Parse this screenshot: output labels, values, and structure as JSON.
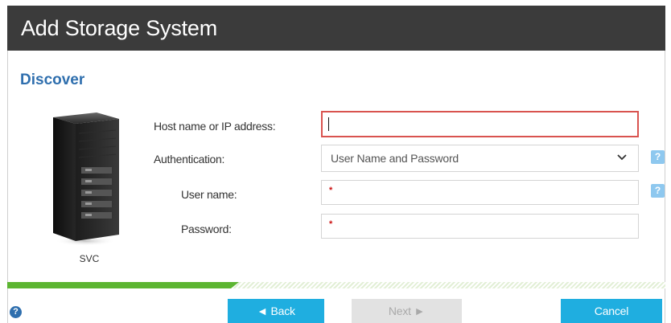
{
  "dialog": {
    "title": "Add Storage System",
    "section_title": "Discover"
  },
  "device": {
    "name": "SVC"
  },
  "form": {
    "host_label": "Host name or IP address:",
    "host_value": "",
    "auth_label": "Authentication:",
    "auth_value": "User Name and Password",
    "username_label": "User name:",
    "username_value": "",
    "password_label": "Password:",
    "password_value": "",
    "help_glyph": "?",
    "required_glyph": "*"
  },
  "progress": {
    "fraction": 0.34
  },
  "footer": {
    "help_glyph": "?",
    "back_label": "◄ Back",
    "next_label": "Next ►",
    "cancel_label": "Cancel"
  },
  "colors": {
    "title_bar": "#3b3b3b",
    "section_title": "#2f6fae",
    "primary_button": "#1faee0",
    "progress": "#5cb531",
    "focused_border": "#d9534f",
    "help_badge": "#8ec8ef"
  }
}
